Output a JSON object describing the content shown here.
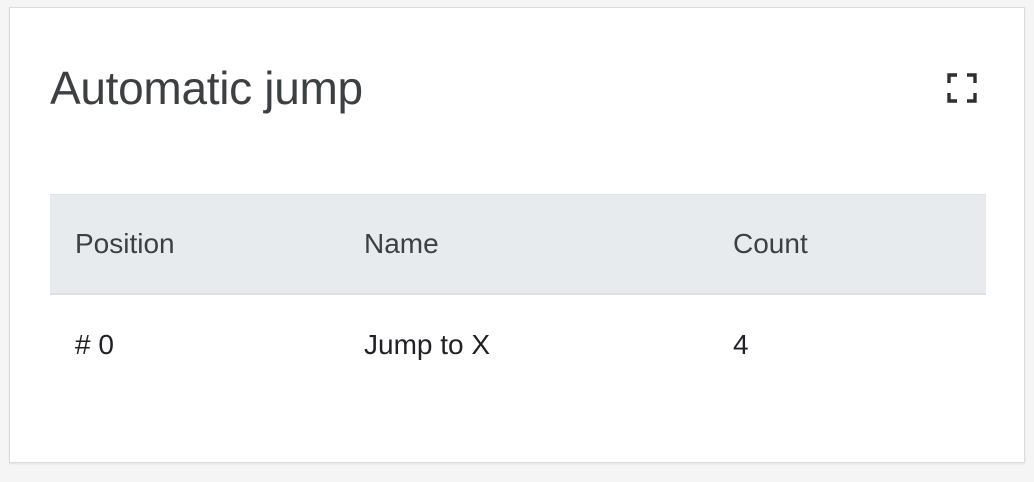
{
  "card": {
    "title": "Automatic jump",
    "fullscreen_icon": "fullscreen-icon"
  },
  "table": {
    "columns": [
      "Position",
      "Name",
      "Count"
    ],
    "rows": [
      {
        "position": "# 0",
        "name": "Jump to X",
        "count": "4"
      }
    ]
  },
  "colors": {
    "header_bg": "#e8ebee",
    "title_text": "#3c4043",
    "cell_text": "#202124"
  }
}
